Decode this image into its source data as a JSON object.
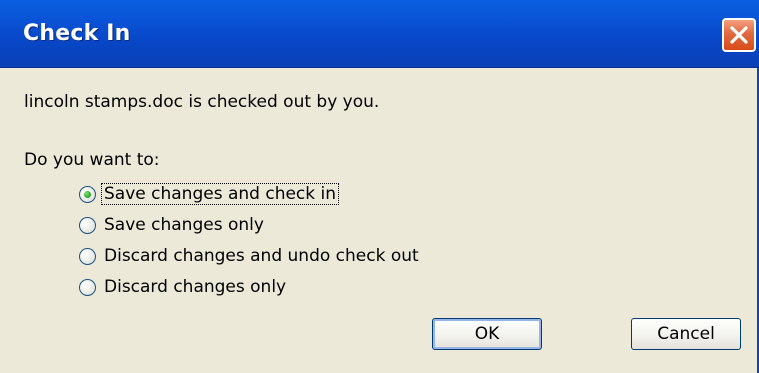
{
  "window": {
    "title": "Check In",
    "close_icon": "close-icon"
  },
  "dialog": {
    "message": "lincoln stamps.doc is checked out by you.",
    "question": "Do you want to:",
    "options": [
      {
        "label": "Save changes and check in",
        "selected": true
      },
      {
        "label": "Save changes only",
        "selected": false
      },
      {
        "label": "Discard changes and undo check out",
        "selected": false
      },
      {
        "label": "Discard changes only",
        "selected": false
      }
    ],
    "ok_label": "OK",
    "cancel_label": "Cancel"
  },
  "colors": {
    "titlebar": "#0a55d8",
    "close_button": "#d84b1a",
    "dialog_background": "#ece9d8",
    "radio_selected": "#21a121"
  }
}
